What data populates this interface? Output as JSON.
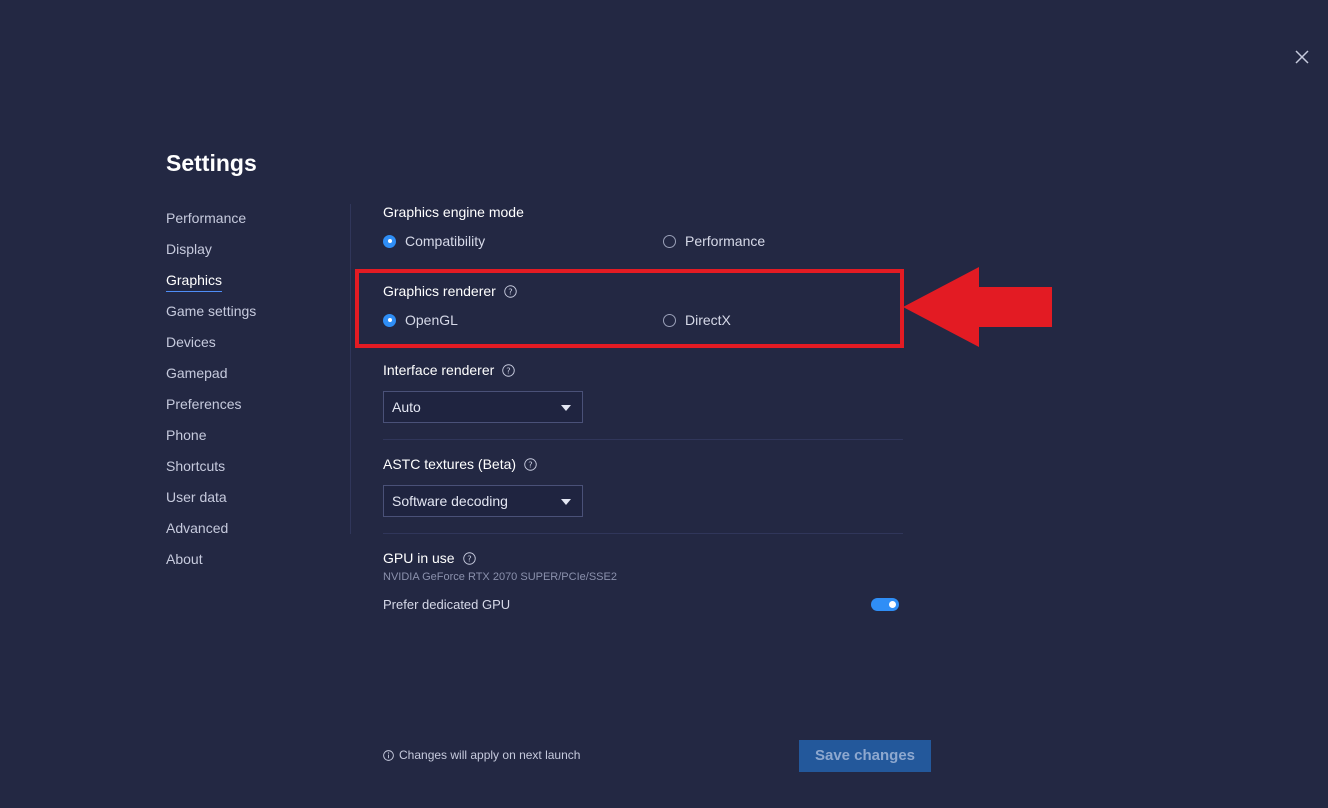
{
  "header": {
    "title": "Settings",
    "close_icon": "close-icon"
  },
  "sidebar": {
    "items": [
      {
        "label": "Performance"
      },
      {
        "label": "Display"
      },
      {
        "label": "Graphics",
        "active": true
      },
      {
        "label": "Game settings"
      },
      {
        "label": "Devices"
      },
      {
        "label": "Gamepad"
      },
      {
        "label": "Preferences"
      },
      {
        "label": "Phone"
      },
      {
        "label": "Shortcuts"
      },
      {
        "label": "User data"
      },
      {
        "label": "Advanced"
      },
      {
        "label": "About"
      }
    ]
  },
  "main": {
    "engine_mode": {
      "title": "Graphics engine mode",
      "options": [
        {
          "label": "Compatibility",
          "checked": true
        },
        {
          "label": "Performance",
          "checked": false
        }
      ]
    },
    "renderer": {
      "title": "Graphics renderer",
      "options": [
        {
          "label": "OpenGL",
          "checked": true
        },
        {
          "label": "DirectX",
          "checked": false
        }
      ]
    },
    "interface_renderer": {
      "title": "Interface renderer",
      "value": "Auto"
    },
    "astc": {
      "title": "ASTC textures (Beta)",
      "value": "Software decoding"
    },
    "gpu": {
      "title": "GPU in use",
      "name": "NVIDIA GeForce RTX 2070 SUPER/PCIe/SSE2",
      "prefer_label": "Prefer dedicated GPU",
      "prefer_enabled": true
    }
  },
  "footer": {
    "note": "Changes will apply on next launch",
    "save_label": "Save changes"
  },
  "colors": {
    "background": "#232843",
    "accent": "#2f8ef6",
    "annotation_red": "#e31b23",
    "save_button": "#23589b"
  }
}
